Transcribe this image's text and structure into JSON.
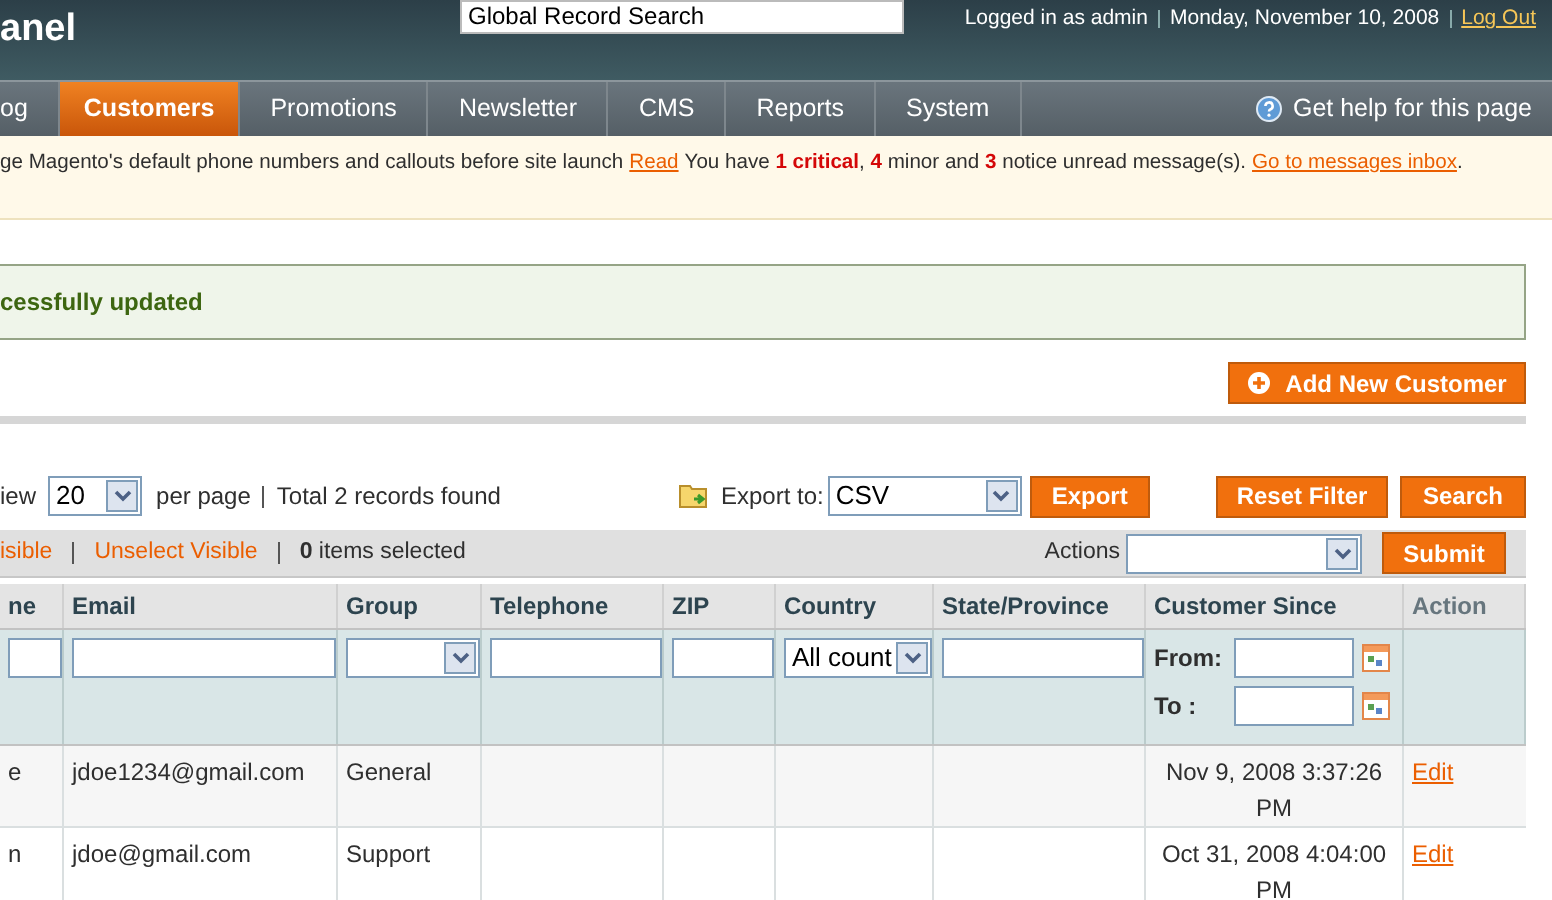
{
  "header": {
    "logo": "anel",
    "search": {
      "value": "Global Record Search"
    },
    "user": "Logged in as admin",
    "date": "Monday, November 10, 2008",
    "logout": "Log Out"
  },
  "nav": {
    "tabs": [
      {
        "label": "og",
        "selected": false
      },
      {
        "label": "Customers",
        "selected": true
      },
      {
        "label": "Promotions",
        "selected": false
      },
      {
        "label": "Newsletter",
        "selected": false
      },
      {
        "label": "CMS",
        "selected": false
      },
      {
        "label": "Reports",
        "selected": false
      },
      {
        "label": "System",
        "selected": false
      }
    ],
    "help": "Get help for this page"
  },
  "notice": {
    "text": "ge Magento's default phone numbers and callouts before site launch",
    "read": "Read",
    "summary": "You have **1 critical**, **4** minor and **3** notice unread message(s).",
    "inbox": "Go to messages inbox",
    "end": "."
  },
  "success": "cessfully updated",
  "add_button": "Add New Customer",
  "pager": {
    "view": "iew",
    "per_page_value": "20",
    "per_page": "per page",
    "total": "Total 2 records found",
    "export_label": "Export to:",
    "export_value": "CSV",
    "export_button": "Export",
    "reset_button": "Reset Filter",
    "search_button": "Search"
  },
  "massaction": {
    "select_visible": "isible",
    "unselect_visible": "Unselect Visible",
    "selected": "**0** items selected",
    "actions_label": "Actions",
    "submit": "Submit"
  },
  "table": {
    "columns": [
      "ne",
      "Email",
      "Group",
      "Telephone",
      "ZIP",
      "Country",
      "State/Province",
      "Customer Since",
      "Action"
    ],
    "filters": [
      {
        "kind": "text"
      },
      {
        "kind": "text"
      },
      {
        "kind": "select"
      },
      {
        "kind": "text"
      },
      {
        "kind": "text"
      },
      {
        "kind": "select",
        "value": "All count"
      },
      {
        "kind": "text"
      },
      {
        "kind": "date",
        "from": "From:",
        "to": "To :"
      },
      {
        "kind": "none"
      }
    ],
    "rows": [
      {
        "cells": [
          "e",
          "jdoe1234@gmail.com",
          "General",
          "",
          "",
          "",
          "",
          "Nov 9, 2008 3:37:26 PM"
        ],
        "action": "Edit"
      },
      {
        "cells": [
          "n",
          "jdoe@gmail.com",
          "Support",
          "",
          "",
          "",
          "",
          "Oct 31, 2008 4:04:00 PM"
        ],
        "action": "Edit"
      }
    ]
  }
}
